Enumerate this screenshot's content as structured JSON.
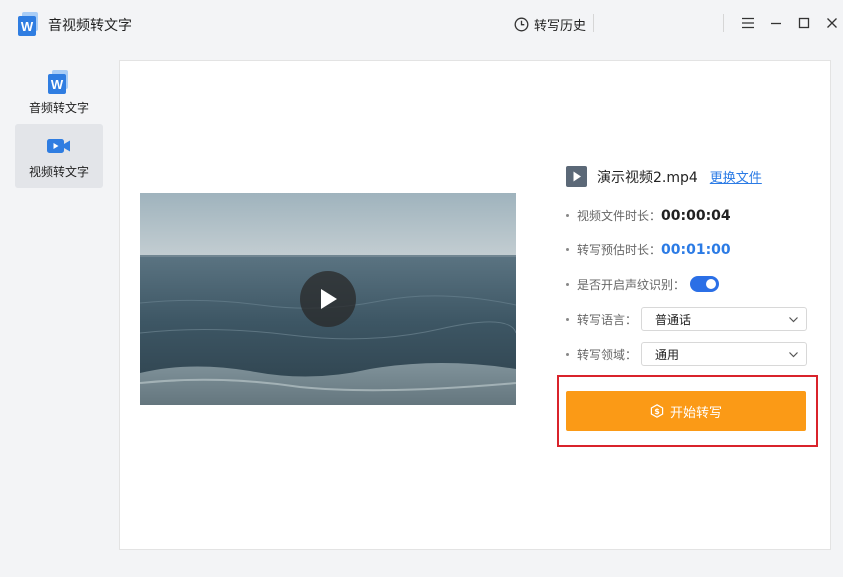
{
  "app": {
    "title": "音视频转文字"
  },
  "header": {
    "history_label": "转写历史"
  },
  "sidebar": {
    "items": [
      {
        "label": "音频转文字",
        "active": false
      },
      {
        "label": "视频转文字",
        "active": true
      }
    ]
  },
  "file": {
    "name": "演示视频2.mp4",
    "change_label": "更换文件"
  },
  "info": {
    "duration_label": "视频文件时长：",
    "duration_value": "00:00:04",
    "estimate_label": "转写预估时长：",
    "estimate_value": "00:01:00",
    "voiceprint_label": "是否开启声纹识别：",
    "voiceprint_enabled": true,
    "language_label": "转写语言：",
    "language_value": "普通话",
    "domain_label": "转写领域：",
    "domain_value": "通用"
  },
  "actions": {
    "start_label": "开始转写"
  },
  "colors": {
    "accent_blue": "#2b6fe6",
    "start_orange": "#fb9a16",
    "highlight_red": "#d9232b"
  }
}
